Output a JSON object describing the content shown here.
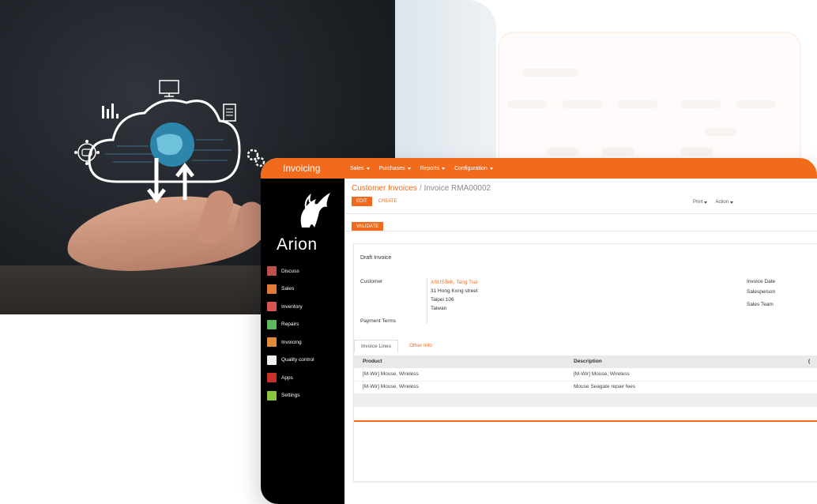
{
  "app": {
    "brand": "Invoicing",
    "top_nav": [
      {
        "label": "Sales"
      },
      {
        "label": "Purchases"
      },
      {
        "label": "Reports"
      },
      {
        "label": "Configuration"
      }
    ],
    "accent_color": "#f26b1d"
  },
  "sidebar": {
    "logo_text": "Arion",
    "items": [
      {
        "label": "Discuss",
        "icon": "chat-icon",
        "color": "#c0504d"
      },
      {
        "label": "Sales",
        "icon": "chart-up-icon",
        "color": "#e07b39"
      },
      {
        "label": "Inventory",
        "icon": "box-icon",
        "color": "#d9534f"
      },
      {
        "label": "Repairs",
        "icon": "wrench-icon",
        "color": "#5cb85c"
      },
      {
        "label": "Invoicing",
        "icon": "invoice-icon",
        "color": "#e08a3c"
      },
      {
        "label": "Quality control",
        "icon": "checklist-icon",
        "color": "#f0f0f0"
      },
      {
        "label": "Apps",
        "icon": "apps-icon",
        "color": "#c9302c"
      },
      {
        "label": "Settings",
        "icon": "gear-icon",
        "color": "#8cc63f"
      }
    ]
  },
  "breadcrumb": {
    "parent": "Customer Invoices",
    "separator": "/",
    "current": "Invoice RMA00002"
  },
  "toolbar": {
    "edit": "EDIT",
    "create": "CREATE",
    "print": "Print",
    "action": "Action",
    "validate": "VALIDATE"
  },
  "invoice": {
    "status": "Draft Invoice",
    "customer_label": "Customer",
    "customer_name": "ASUSTeK, Tang Tsui",
    "address": [
      "31 Hong Kong street",
      "Taipei 106",
      "Taiwan"
    ],
    "payment_terms_label": "Payment Terms",
    "invoice_date_label": "Invoice Date",
    "salesperson_label": "Salesperson",
    "sales_team_label": "Sales Team"
  },
  "tabs": [
    {
      "label": "Invoice Lines"
    },
    {
      "label": "Other Info"
    }
  ],
  "lines": {
    "columns": [
      "Product",
      "Description",
      "("
    ],
    "rows": [
      {
        "product": "[M-Wir] Mouse, Wireless",
        "description": "[M-Wir] Mouse, Wireless"
      },
      {
        "product": "[M-Wir] Mouse, Wireless",
        "description": "Mouse Seagate repair fees"
      }
    ]
  }
}
